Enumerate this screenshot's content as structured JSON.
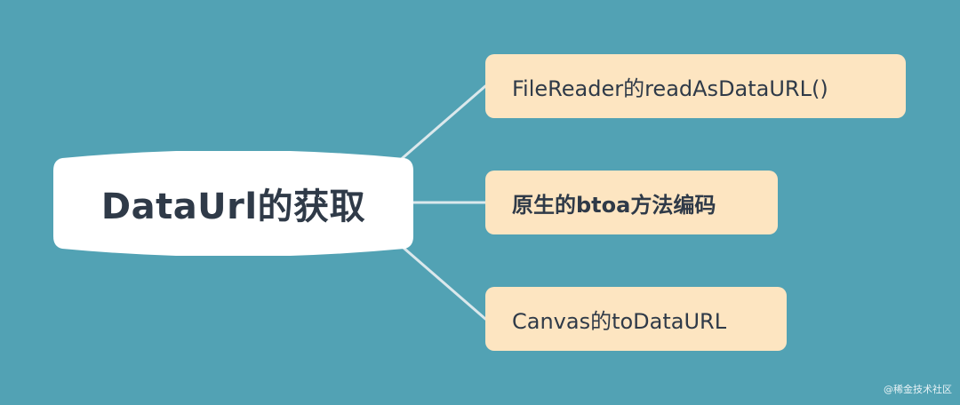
{
  "mindmap": {
    "root": {
      "label": "DataUrl的获取"
    },
    "children": [
      {
        "label": "FileReader的readAsDataURL()"
      },
      {
        "label": "原生的btoa方法编码"
      },
      {
        "label": "Canvas的toDataURL"
      }
    ]
  },
  "watermark": {
    "text": "@稀金技术社区"
  },
  "colors": {
    "background": "#52a2b4",
    "root_fill": "#ffffff",
    "child_fill": "#fde5c1",
    "text": "#2f3a48",
    "connector": "#dbe8ec"
  }
}
